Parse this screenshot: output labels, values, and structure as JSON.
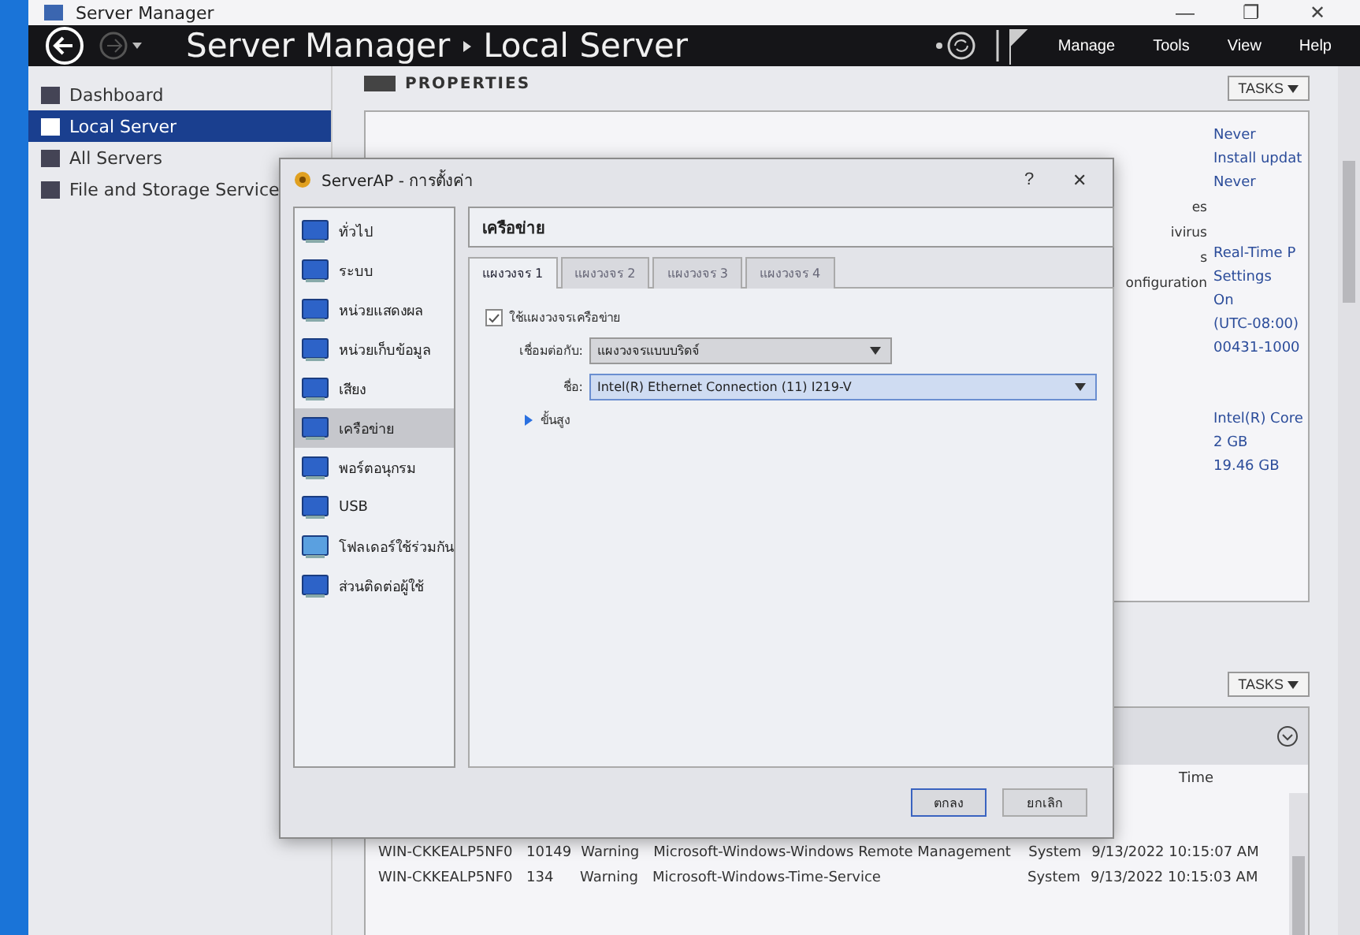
{
  "window": {
    "title": "Server Manager",
    "controls": [
      "—",
      "❐",
      "✕"
    ]
  },
  "header": {
    "breadcrumb": [
      "Server Manager",
      "Local Server"
    ],
    "menu": [
      "Manage",
      "Tools",
      "View",
      "Help"
    ]
  },
  "sidebar": {
    "items": [
      {
        "label": "Dashboard",
        "selected": false
      },
      {
        "label": "Local Server",
        "selected": true
      },
      {
        "label": "All Servers",
        "selected": false
      },
      {
        "label": "File and Storage Service",
        "selected": false
      }
    ]
  },
  "properties": {
    "title": "PROPERTIES",
    "tasks": "TASKS",
    "labels": [
      "es",
      "ivirus",
      "s",
      "onfiguration"
    ],
    "value_groups": [
      [
        "Never",
        "Install updat",
        "Never"
      ],
      [
        "Real-Time P",
        "Settings",
        "On",
        "(UTC-08:00)",
        "00431-1000"
      ],
      [
        "Intel(R) Core",
        "2 GB",
        "19.46 GB"
      ]
    ]
  },
  "events": {
    "tasks": "TASKS",
    "column_time": "Time",
    "rows": [
      [
        "WIN-CKKEALP5NF0",
        "10149",
        "Warning",
        "Microsoft-Windows-Windows Remote Management",
        "System",
        "9/13/2022 10:15:07 AM"
      ],
      [
        "WIN-CKKEALP5NF0",
        "134",
        "Warning",
        "Microsoft-Windows-Time-Service",
        "System",
        "9/13/2022 10:15:03 AM"
      ]
    ]
  },
  "dialog": {
    "title": "ServerAP - การตั้งค่า",
    "help": "?",
    "close": "✕",
    "categories": [
      {
        "label": "ทั่วไป",
        "selected": false
      },
      {
        "label": "ระบบ",
        "selected": false
      },
      {
        "label": "หน่วยแสดงผล",
        "selected": false
      },
      {
        "label": "หน่วยเก็บข้อมูล",
        "selected": false
      },
      {
        "label": "เสียง",
        "selected": false
      },
      {
        "label": "เครือข่าย",
        "selected": true
      },
      {
        "label": "พอร์ตอนุกรม",
        "selected": false
      },
      {
        "label": "USB",
        "selected": false
      },
      {
        "label": "โฟลเดอร์ใช้ร่วมกัน",
        "selected": false
      },
      {
        "label": "ส่วนติดต่อผู้ใช้",
        "selected": false
      }
    ],
    "section_title": "เครือข่าย",
    "tabs": [
      {
        "label": "แผงวงจร 1",
        "selected": true
      },
      {
        "label": "แผงวงจร 2",
        "selected": false
      },
      {
        "label": "แผงวงจร 3",
        "selected": false
      },
      {
        "label": "แผงวงจร 4",
        "selected": false
      }
    ],
    "enable": {
      "label": "ใช้แผงวงจรเครือข่าย",
      "checked": true
    },
    "attached_label": "เชื่อมต่อกับ:",
    "attached_value": "แผงวงจรแบบบริดจ์",
    "name_label": "ชื่อ:",
    "name_value": "Intel(R) Ethernet Connection (11) I219-V",
    "advanced": {
      "label": "ขั้นสูง",
      "expanded": false
    },
    "buttons": [
      "ตกลง",
      "ยกเลิก"
    ]
  }
}
